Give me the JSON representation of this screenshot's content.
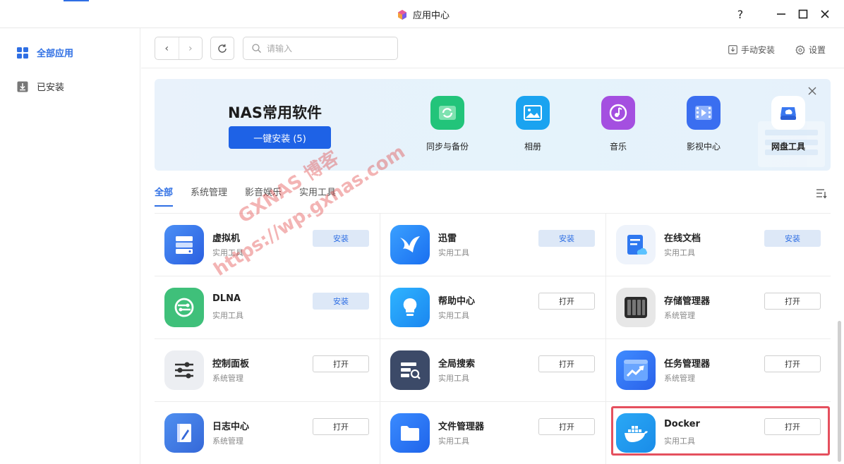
{
  "window": {
    "title": "应用中心",
    "help": "?",
    "minimize": "—",
    "maximize": "☐",
    "close": "✕"
  },
  "sidebar": {
    "items": [
      {
        "label": "全部应用",
        "icon": "grid-icon",
        "active": true
      },
      {
        "label": "已安装",
        "icon": "download-icon",
        "active": false
      }
    ]
  },
  "toolbar": {
    "back": "‹",
    "forward": "›",
    "search_placeholder": "请输入",
    "manual_install": "手动安装",
    "settings": "设置"
  },
  "banner": {
    "title": "NAS常用软件",
    "install_all": "一键安装 (5)",
    "close": "✕",
    "apps": [
      {
        "label": "同步与备份",
        "color": "#22c47a",
        "icon": "sync-icon"
      },
      {
        "label": "相册",
        "color": "#1aa3f0",
        "icon": "photo-icon"
      },
      {
        "label": "音乐",
        "color": "#a44fe0",
        "icon": "music-icon"
      },
      {
        "label": "影视中心",
        "color": "#3a6ef0",
        "icon": "video-icon"
      },
      {
        "label": "网盘工具",
        "color": "#ffffff",
        "icon": "cloud-drive-icon"
      }
    ]
  },
  "tabs": [
    {
      "label": "全部",
      "active": true
    },
    {
      "label": "系统管理",
      "active": false
    },
    {
      "label": "影音娱乐",
      "active": false
    },
    {
      "label": "实用工具",
      "active": false
    }
  ],
  "apps": [
    {
      "name": "虚拟机",
      "category": "实用工具",
      "button": "安装",
      "type": "install",
      "icon": "virtual-machine-icon"
    },
    {
      "name": "迅雷",
      "category": "实用工具",
      "button": "安装",
      "type": "install",
      "icon": "xunlei-icon"
    },
    {
      "name": "在线文档",
      "category": "实用工具",
      "button": "安装",
      "type": "install",
      "icon": "online-doc-icon"
    },
    {
      "name": "DLNA",
      "category": "实用工具",
      "button": "安装",
      "type": "install",
      "icon": "dlna-icon"
    },
    {
      "name": "帮助中心",
      "category": "实用工具",
      "button": "打开",
      "type": "open",
      "icon": "help-center-icon"
    },
    {
      "name": "存储管理器",
      "category": "系统管理",
      "button": "打开",
      "type": "open",
      "icon": "storage-icon"
    },
    {
      "name": "控制面板",
      "category": "系统管理",
      "button": "打开",
      "type": "open",
      "icon": "control-panel-icon"
    },
    {
      "name": "全局搜索",
      "category": "实用工具",
      "button": "打开",
      "type": "open",
      "icon": "global-search-icon"
    },
    {
      "name": "任务管理器",
      "category": "系统管理",
      "button": "打开",
      "type": "open",
      "icon": "task-manager-icon"
    },
    {
      "name": "日志中心",
      "category": "系统管理",
      "button": "打开",
      "type": "open",
      "icon": "log-center-icon"
    },
    {
      "name": "文件管理器",
      "category": "实用工具",
      "button": "打开",
      "type": "open",
      "icon": "file-manager-icon"
    },
    {
      "name": "Docker",
      "category": "实用工具",
      "button": "打开",
      "type": "open",
      "icon": "docker-icon"
    }
  ],
  "watermark": {
    "line1": "GXNAS 博客",
    "line2": "https://wp.gxnas.com"
  },
  "colors": {
    "accent": "#2f6fe4",
    "install_bg": "#dde8f7",
    "highlight": "#e5505e"
  }
}
